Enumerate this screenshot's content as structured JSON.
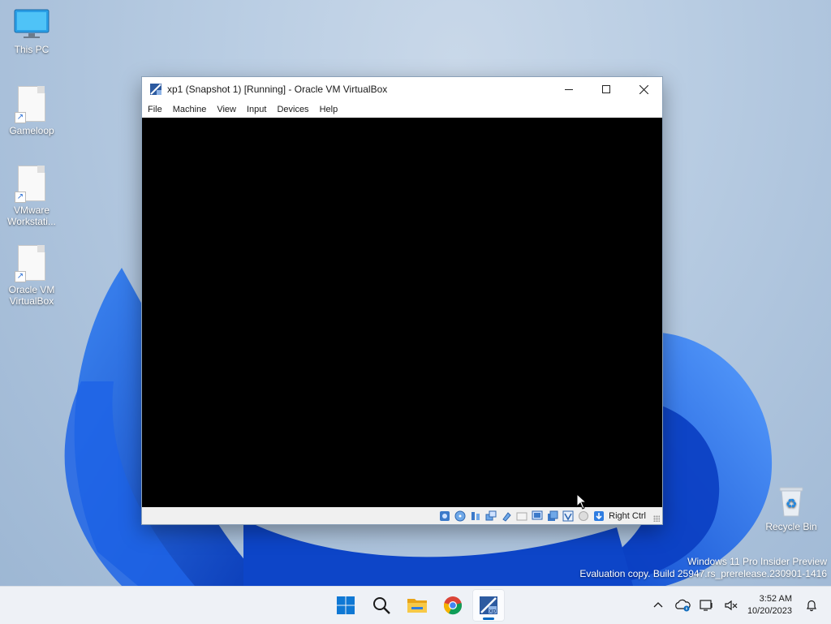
{
  "desktop": {
    "icons": [
      {
        "label": "This PC",
        "icon": "computer-monitor-icon"
      },
      {
        "label": "Gameloop",
        "icon": "shortcut-file-icon"
      },
      {
        "label": "VMware Workstati...",
        "icon": "shortcut-file-icon"
      },
      {
        "label": "Oracle VM VirtualBox",
        "icon": "shortcut-file-icon"
      },
      {
        "label": "Recycle Bin",
        "icon": "recycle-bin-icon"
      }
    ]
  },
  "window": {
    "title": "xp1 (Snapshot 1) [Running] - Oracle VM VirtualBox",
    "menu": [
      "File",
      "Machine",
      "View",
      "Input",
      "Devices",
      "Help"
    ],
    "host_key": "Right Ctrl"
  },
  "watermark": {
    "line1": "Windows 11 Pro Insider Preview",
    "line2": "Evaluation copy. Build 25947.rs_prerelease.230901-1416"
  },
  "taskbar": {
    "apps": [
      "start-icon",
      "search-icon",
      "file-explorer-icon",
      "chrome-icon",
      "virtualbox-icon"
    ],
    "clock": {
      "time": "3:52 AM",
      "date": "10/20/2023"
    }
  },
  "colors": {
    "accent": "#0067c0",
    "bloom": "#1a5fe0"
  }
}
